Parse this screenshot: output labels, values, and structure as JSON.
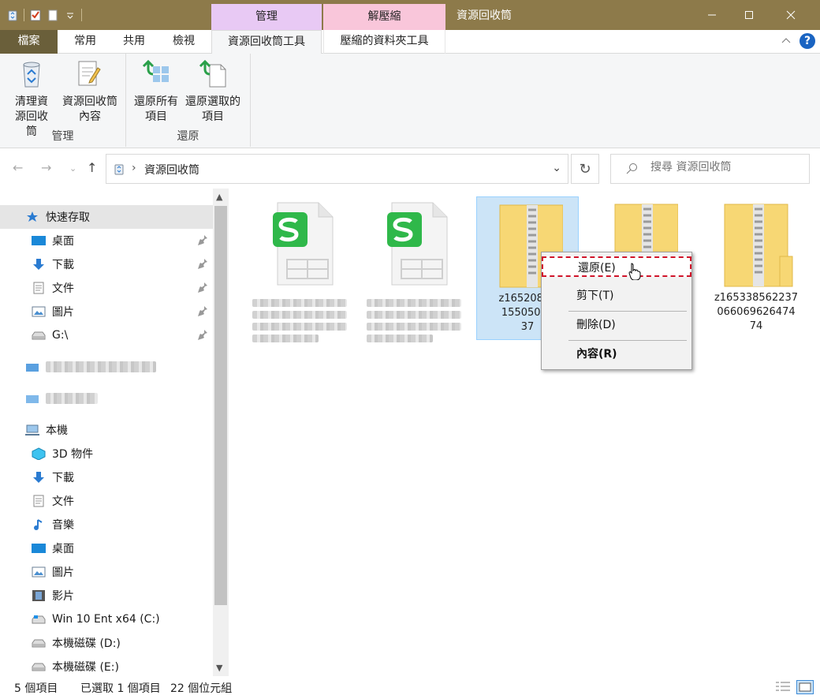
{
  "window": {
    "title": "資源回收筒",
    "context_groups": {
      "manage": "管理",
      "unzip": "解壓縮"
    }
  },
  "tabs": {
    "file": "檔案",
    "home": "常用",
    "share": "共用",
    "view": "檢視",
    "recycle_bin_tools": "資源回收筒工具",
    "zip_tools": "壓縮的資料夾工具"
  },
  "ribbon": {
    "groups": [
      {
        "label": "管理",
        "buttons": [
          {
            "label": "清理資源回收筒",
            "icon": "empty-recycle-bin-icon"
          },
          {
            "label": "資源回收筒內容",
            "icon": "properties-icon"
          }
        ]
      },
      {
        "label": "還原",
        "buttons": [
          {
            "label": "還原所有項目",
            "icon": "restore-all-icon"
          },
          {
            "label": "還原選取的項目",
            "icon": "restore-selected-icon"
          }
        ]
      }
    ]
  },
  "address": {
    "crumb": "資源回收筒",
    "search_placeholder": "搜尋 資源回收筒"
  },
  "nav": {
    "quick_access": "快速存取",
    "quick_items": [
      "桌面",
      "下載",
      "文件",
      "圖片",
      "G:\\"
    ],
    "this_pc": "本機",
    "pc_items": [
      "3D 物件",
      "下載",
      "文件",
      "音樂",
      "桌面",
      "圖片",
      "影片",
      "Win 10 Ent x64 (C:)",
      "本機磁碟 (D:)",
      "本機磁碟 (E:)"
    ]
  },
  "files": [
    {
      "type": "spreadsheet",
      "name": ""
    },
    {
      "type": "spreadsheet",
      "name": ""
    },
    {
      "type": "zip",
      "name": "z165208751550508637",
      "name_lines": [
        "z16520875",
        "15505086",
        "37"
      ],
      "selected": true
    },
    {
      "type": "zip",
      "name": ""
    },
    {
      "type": "zip",
      "name": "z16533856223706606962647474",
      "name_lines": [
        "z165338562237",
        "066069626474",
        "74"
      ]
    }
  ],
  "context_menu": {
    "items": [
      "還原(E)",
      "剪下(T)",
      "刪除(D)",
      "內容(R)"
    ]
  },
  "status": {
    "count": "5 個項目",
    "selection": "已選取 1 個項目",
    "size": "22 個位元組"
  },
  "colors": {
    "titlebar": "#8d7a4a",
    "selection": "#cce4f7",
    "highlight_border": "#d0142a"
  }
}
